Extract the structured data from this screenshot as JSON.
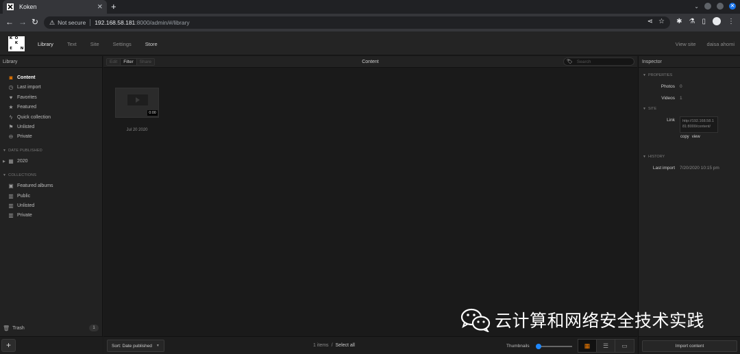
{
  "browser": {
    "tab_title": "Koken",
    "security_label": "Not secure",
    "url_host": "192.168.58.181",
    "url_path": ":8000/admin/#/library"
  },
  "header": {
    "logo_letters": [
      "K",
      "O",
      "",
      "",
      "K",
      "",
      "E",
      "",
      "N"
    ],
    "nav": [
      "Library",
      "Text",
      "Site",
      "Settings",
      "Store"
    ],
    "view_site": "View site",
    "user": "daisa ahomi"
  },
  "sidebar": {
    "title": "Library",
    "items": [
      {
        "label": "Content",
        "icon": "camera-icon"
      },
      {
        "label": "Last import",
        "icon": "clock-icon"
      },
      {
        "label": "Favorites",
        "icon": "heart-icon"
      },
      {
        "label": "Featured",
        "icon": "star-icon"
      },
      {
        "label": "Quick collection",
        "icon": "bolt-icon"
      },
      {
        "label": "Unlisted",
        "icon": "unlisted-icon"
      },
      {
        "label": "Private",
        "icon": "private-icon"
      }
    ],
    "date_section": "DATE PUBLISHED",
    "year": "2020",
    "collections_section": "COLLECTIONS",
    "collections": [
      {
        "label": "Featured albums"
      },
      {
        "label": "Public"
      },
      {
        "label": "Unlisted"
      },
      {
        "label": "Private"
      }
    ],
    "trash_label": "Trash",
    "trash_count": "1",
    "add_label": "+"
  },
  "content": {
    "tools": [
      "Edit",
      "Filter",
      "Share"
    ],
    "title": "Content",
    "search_placeholder": "Search",
    "items": [
      {
        "duration": "0:00",
        "date": "Jul 20 2020"
      }
    ],
    "sort_label": "Sort: Date published",
    "item_count": "1 items",
    "select_all": "Select all",
    "thumbnails_label": "Thumbnails",
    "thumbnail_size": 0.05
  },
  "inspector": {
    "title": "Inspector",
    "properties_section": "PROPERTIES",
    "photos_label": "Photos",
    "photos_value": "0",
    "videos_label": "Videos",
    "videos_value": "1",
    "site_section": "SITE",
    "link_label": "Link",
    "link_value": "http://192.168.58.181:8000/content/",
    "copy_label": "copy",
    "view_label": "view",
    "history_section": "HISTORY",
    "last_import_label": "Last import",
    "last_import_value": "7/20/2020 10:15 pm",
    "import_button": "Import content"
  },
  "watermark": {
    "text": "云计算和网络安全技术实践"
  },
  "colors": {
    "accent": "#f27c00",
    "slider": "#1e88ff"
  }
}
